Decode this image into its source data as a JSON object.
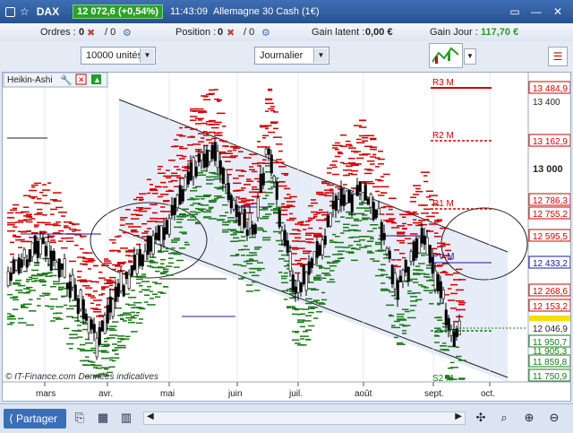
{
  "titlebar": {
    "symbol": "DAX",
    "price_change": "12 072,6 (+0,54%)",
    "time": "11:43:09",
    "instrument": "Allemagne 30 Cash (1€)"
  },
  "positions_bar": {
    "orders_label": "Ordres :",
    "orders_value": "0",
    "orders_sep": "/ 0",
    "position_label": "Position :",
    "position_value": "0",
    "position_sep": "/ 0",
    "latent_label": "Gain latent :",
    "latent_value": "0,00 €",
    "day_label": "Gain Jour :",
    "day_value": "117,70 €"
  },
  "controls": {
    "quantity": "10000 unités",
    "period": "Journalier"
  },
  "chart_header": {
    "indicator": "Heikin-Ashi"
  },
  "pivot_labels": [
    "R3 M",
    "R2 M",
    "R1 M",
    "PV M",
    "S2 M"
  ],
  "price_labels": [
    "13 484,9",
    "13 400",
    "13 162,9",
    "13 000",
    "12 786,3",
    "12 755,2",
    "12 595,5",
    "12 433,2",
    "12 268,6",
    "12 153,2",
    "12 046,9",
    "11 950,7",
    "11 905,3",
    "11 859,8",
    "11 750,9"
  ],
  "x_labels": [
    "mars",
    "avr.",
    "mai",
    "juin",
    "juil.",
    "août",
    "sept.",
    "oct."
  ],
  "footer": {
    "copyright": "© IT-Finance.com Données indicatives",
    "share": "Partager"
  },
  "chart_data": {
    "type": "candlestick",
    "x_ticks": [
      "mars",
      "avr.",
      "mai",
      "juin",
      "juil.",
      "août",
      "sept.",
      "oct."
    ],
    "y_ticks": [
      "13 400",
      "13 000"
    ],
    "pivots": [
      {
        "name": "R3 M",
        "value": 13484.9
      },
      {
        "name": "R2 M",
        "value": 13162.9
      },
      {
        "name": "R1 M",
        "value": 12786.3
      },
      {
        "name": "PV M",
        "value": 12433.2
      },
      {
        "name": "S2 M",
        "value": 11750.9
      }
    ],
    "last_price": 12046.9,
    "colors": {
      "pivot": "#d40000",
      "support": "#1a7a1a",
      "accent": "#3a6fb7"
    }
  }
}
